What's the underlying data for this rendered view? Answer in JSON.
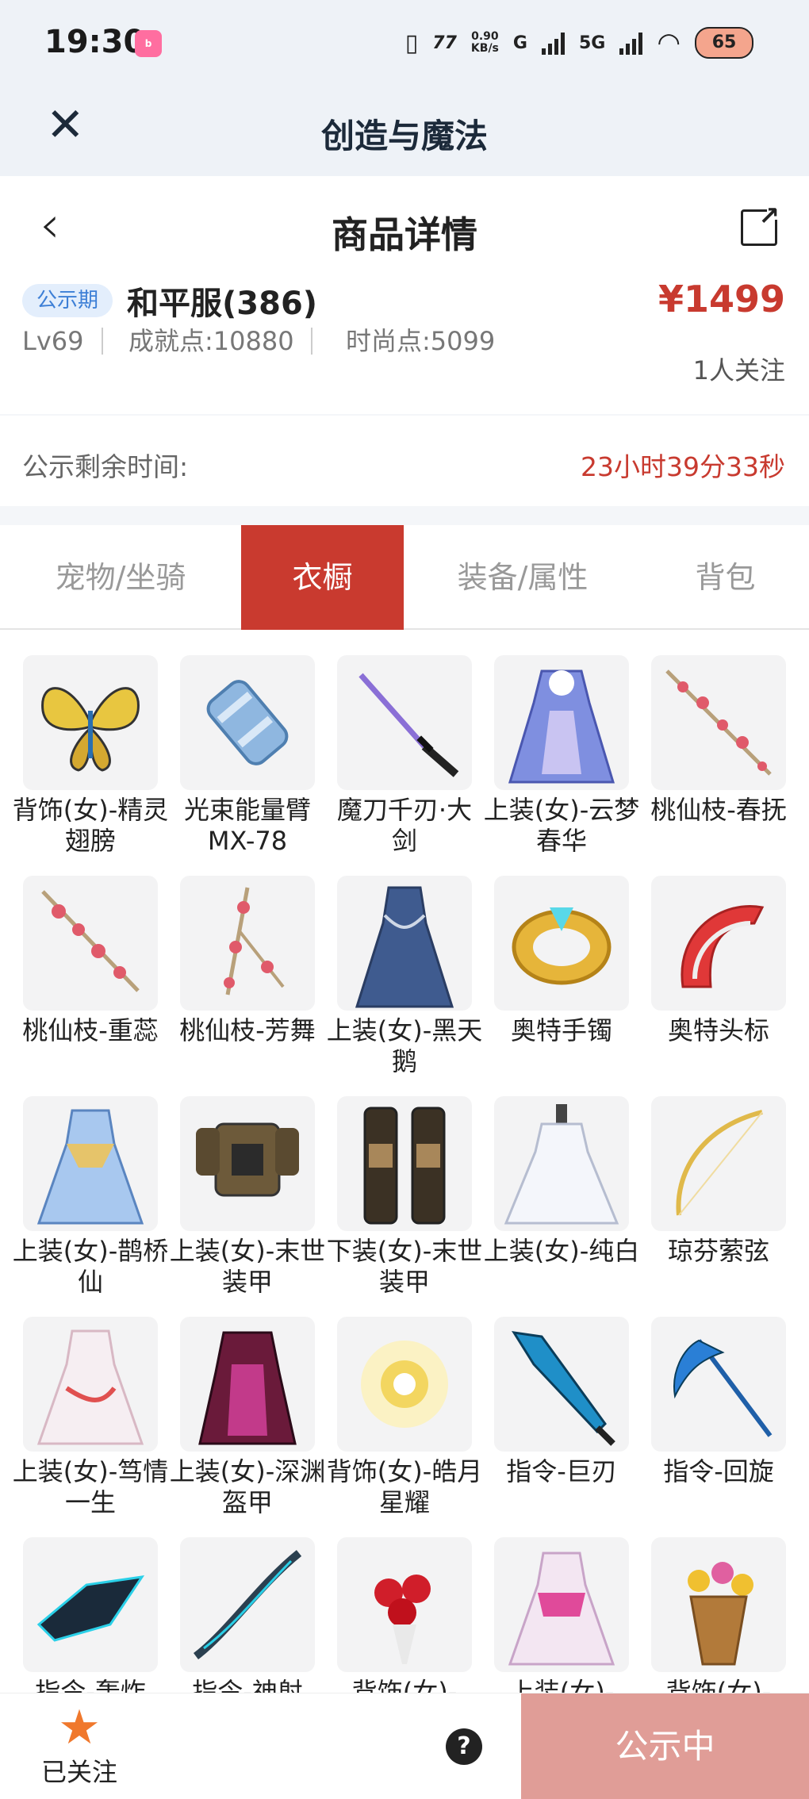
{
  "status_bar": {
    "time": "19:30",
    "app_badge": "bilibili",
    "net_speed_value": "0.90",
    "net_speed_unit": "KB/s",
    "net1": "G",
    "net2": "5G",
    "battery": "65"
  },
  "app_header": {
    "title": "创造与魔法"
  },
  "nav": {
    "title": "商品详情"
  },
  "listing": {
    "badge": "公示期",
    "server": "和平服(386)",
    "price": "¥1499",
    "level": "Lv69",
    "achievement": "成就点:10880",
    "fashion": "时尚点:5099",
    "followers": "1人关注"
  },
  "countdown": {
    "label": "公示剩余时间:",
    "value": "23小时39分33秒"
  },
  "tabs": [
    {
      "label": "宠物/坐骑",
      "active": false
    },
    {
      "label": "衣橱",
      "active": true
    },
    {
      "label": "装备/属性",
      "active": false
    },
    {
      "label": "背包",
      "active": false
    }
  ],
  "items": [
    {
      "name": "背饰(女)-精灵翅膀",
      "icon": "butterfly-wings-icon"
    },
    {
      "name": "光束能量臂MX-78",
      "icon": "energy-arm-icon"
    },
    {
      "name": "魔刀千刃·大剑",
      "icon": "katana-icon"
    },
    {
      "name": "上装(女)-云梦春华",
      "icon": "dress-icon"
    },
    {
      "name": "桃仙枝-春抚",
      "icon": "peach-branch-icon"
    },
    {
      "name": "桃仙枝-重蕊",
      "icon": "peach-branch-icon"
    },
    {
      "name": "桃仙枝-芳舞",
      "icon": "peach-branch-icon"
    },
    {
      "name": "上装(女)-黑天鹅",
      "icon": "dress-icon"
    },
    {
      "name": "奥特手镯",
      "icon": "bracelet-icon"
    },
    {
      "name": "奥特头标",
      "icon": "headpiece-icon"
    },
    {
      "name": "上装(女)-鹊桥仙",
      "icon": "dress-icon"
    },
    {
      "name": "上装(女)-末世装甲",
      "icon": "armor-icon"
    },
    {
      "name": "下装(女)-末世装甲",
      "icon": "armor-legs-icon"
    },
    {
      "name": "上装(女)-纯白",
      "icon": "dress-icon"
    },
    {
      "name": "琼芬萦弦",
      "icon": "bow-icon"
    },
    {
      "name": "上装(女)-笃情一生",
      "icon": "dress-icon"
    },
    {
      "name": "上装(女)-深渊盔甲",
      "icon": "armor-icon"
    },
    {
      "name": "背饰(女)-皓月星耀",
      "icon": "moon-orb-icon"
    },
    {
      "name": "指令-巨刃",
      "icon": "blade-icon"
    },
    {
      "name": "指令-回旋",
      "icon": "scythe-icon"
    },
    {
      "name": "指令-轰炸",
      "icon": "drone-icon"
    },
    {
      "name": "指令-神射",
      "icon": "bow-icon"
    },
    {
      "name": "背饰(女)-",
      "icon": "rose-bouquet-icon"
    },
    {
      "name": "上装(女)-",
      "icon": "dress-icon"
    },
    {
      "name": "背饰(女)-",
      "icon": "flower-basket-icon"
    }
  ],
  "bottom_bar": {
    "follow_label": "已关注",
    "help_symbol": "?",
    "cta_label": "公示中"
  },
  "colors": {
    "accent": "#c93a2f",
    "badge_bg": "#e3eefc",
    "badge_text": "#3d7fd6",
    "cta_disabled": "#e09d97",
    "star": "#f0782c"
  }
}
